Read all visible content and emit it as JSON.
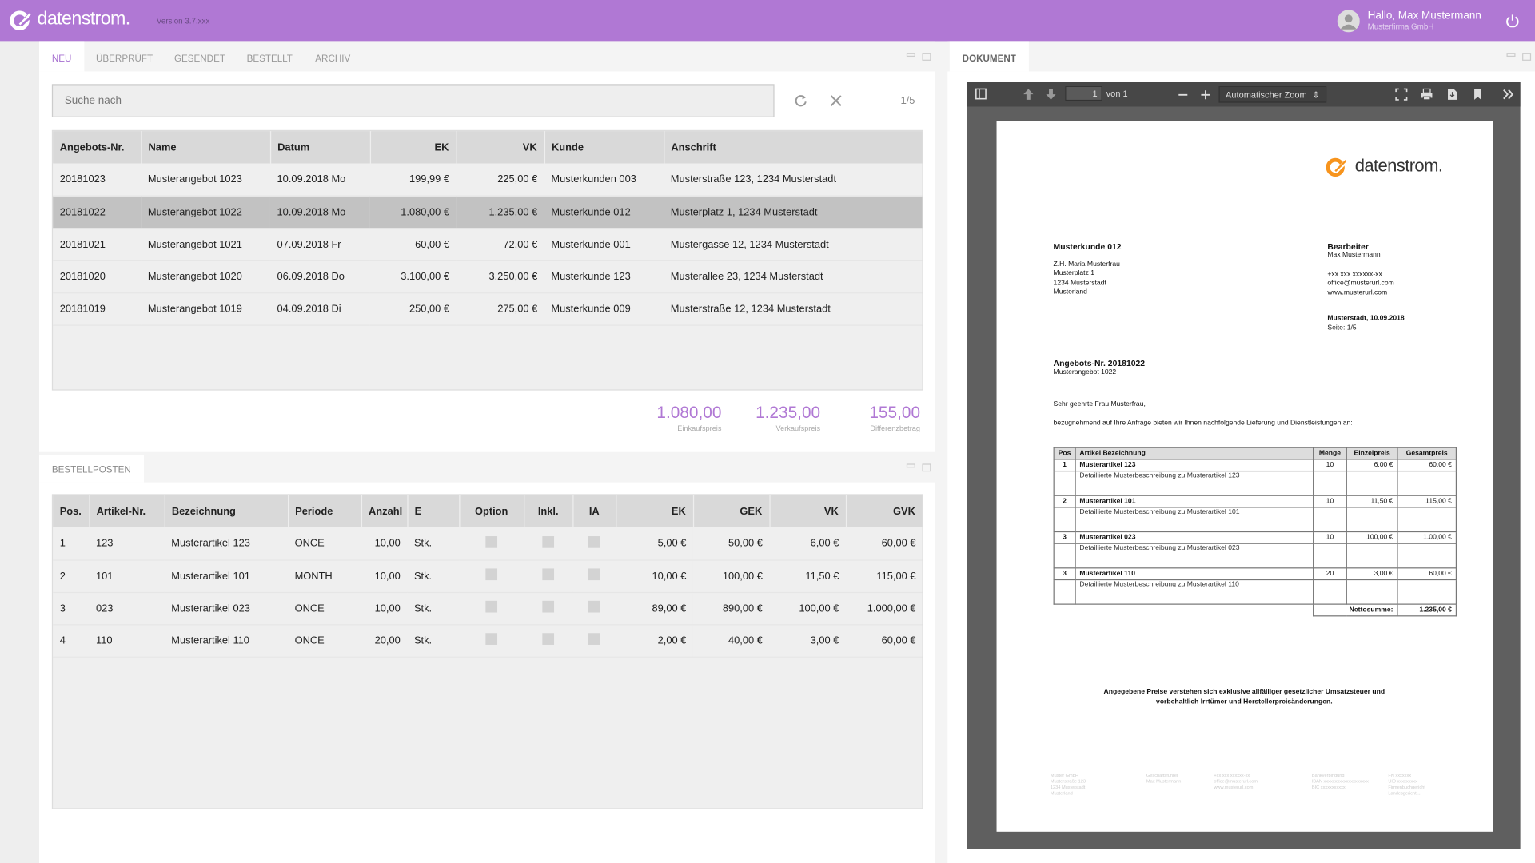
{
  "app": {
    "brand": "datenstrom.",
    "version": "Version 3.7.xxx",
    "accent": "#b078d4"
  },
  "user": {
    "greeting": "Hallo, Max Mustermann",
    "company": "Musterfirma GmbH"
  },
  "sidebar": {
    "items": [
      {
        "icon": "home-icon"
      },
      {
        "icon": "play-icon"
      },
      {
        "icon": "database-icon"
      },
      {
        "icon": "chart-ring-icon"
      },
      {
        "icon": "calculator-icon"
      },
      {
        "icon": "cube-icon"
      },
      {
        "icon": "calendar-icon"
      },
      {
        "icon": "document-icon"
      },
      {
        "icon": "ticket-icon"
      },
      {
        "icon": "shield-user-icon"
      }
    ],
    "settings_icon": "gear-icon"
  },
  "offers": {
    "tabs": [
      "NEU",
      "ÜBERPRÜFT",
      "GESENDET",
      "BESTELLT",
      "ARCHIV"
    ],
    "active_tab": "NEU",
    "search_placeholder": "Suche nach",
    "pager": "1/5",
    "columns": [
      "Angebots-Nr.",
      "Name",
      "Datum",
      "EK",
      "VK",
      "Kunde",
      "Anschrift"
    ],
    "rows": [
      [
        "20181023",
        "Musterangebot 1023",
        "10.09.2018 Mo",
        "199,99 €",
        "225,00 €",
        "Musterkunden 003",
        "Musterstraße 123, 1234 Musterstadt"
      ],
      [
        "20181022",
        "Musterangebot 1022",
        "10.09.2018 Mo",
        "1.080,00 €",
        "1.235,00 €",
        "Musterkunde 012",
        "Musterplatz 1, 1234 Musterstadt"
      ],
      [
        "20181021",
        "Musterangebot 1021",
        "07.09.2018 Fr",
        "60,00 €",
        "72,00 €",
        "Musterkunde 001",
        "Mustergasse 12, 1234 Musterstadt"
      ],
      [
        "20181020",
        "Musterangebot 1020",
        "06.09.2018 Do",
        "3.100,00 €",
        "3.250,00 €",
        "Musterkunde 123",
        "Musterallee 23, 1234 Musterstadt"
      ],
      [
        "20181019",
        "Musterangebot 1019",
        "04.09.2018 Di",
        "250,00 €",
        "275,00 €",
        "Musterkunde 009",
        "Musterstraße 12, 1234 Musterstadt"
      ]
    ],
    "selected_row": 1,
    "sums": [
      {
        "value": "1.080,00",
        "label": "Einkaufspreis"
      },
      {
        "value": "1.235,00",
        "label": "Verkaufspreis"
      },
      {
        "value": "155,00",
        "label": "Differenzbetrag"
      }
    ]
  },
  "positions": {
    "tab": "BESTELLPOSTEN",
    "columns": [
      "Pos.",
      "Artikel-Nr.",
      "Bezeichnung",
      "Periode",
      "Anzahl",
      "E",
      "Option",
      "Inkl.",
      "IA",
      "EK",
      "GEK",
      "VK",
      "GVK"
    ],
    "rows": [
      [
        "1",
        "123",
        "Musterartikel 123",
        "ONCE",
        "10,00",
        "Stk.",
        false,
        false,
        false,
        "5,00 €",
        "50,00 €",
        "6,00 €",
        "60,00 €"
      ],
      [
        "2",
        "101",
        "Musterartikel 101",
        "MONTH",
        "10,00",
        "Stk.",
        false,
        false,
        false,
        "10,00 €",
        "100,00 €",
        "11,50 €",
        "115,00 €"
      ],
      [
        "3",
        "023",
        "Musterartikel 023",
        "ONCE",
        "10,00",
        "Stk.",
        false,
        false,
        false,
        "89,00 €",
        "890,00 €",
        "100,00 €",
        "1.000,00 €"
      ],
      [
        "4",
        "110",
        "Musterartikel 110",
        "ONCE",
        "20,00",
        "Stk.",
        false,
        false,
        false,
        "2,00 €",
        "40,00 €",
        "3,00 €",
        "60,00 €"
      ]
    ]
  },
  "document": {
    "tab": "DOKUMENT",
    "viewer": {
      "page": "1",
      "of": "von 1",
      "zoom": "Automatischer Zoom"
    },
    "customer": {
      "name": "Musterkunde 012",
      "lines": [
        "Z.H. Maria Musterfrau",
        "Musterplatz 1",
        "1234 Musterstadt",
        "Musterland"
      ]
    },
    "clerk": {
      "title": "Bearbeiter",
      "name": "Max Mustermann",
      "lines": [
        "+xx xxx xxxxxx-xx",
        "office@musterurl.com",
        "www.musterurl.com"
      ]
    },
    "place_date": "Musterstadt, 10.09.2018",
    "page_info": "Seite: 1/5",
    "offer_no": "Angebots-Nr. 20181022",
    "offer_name": "Musterangebot 1022",
    "salutation": "Sehr geehrte Frau Musterfrau,",
    "intro": "bezugnehmend auf Ihre Anfrage bieten wir Ihnen nachfolgende Lieferung und Dienstleistungen an:",
    "table_columns": [
      "Pos",
      "Artikel Bezeichnung",
      "Menge",
      "Einzelpreis",
      "Gesamtpreis"
    ],
    "items": [
      {
        "pos": "1",
        "name": "Musterartikel 123",
        "desc": "Detaillierte Musterbeschreibung zu Musterartikel 123",
        "qty": "10",
        "unit": "6,00 €",
        "total": "60,00 €"
      },
      {
        "pos": "2",
        "name": "Musterartikel 101",
        "desc": "Detaillierte Musterbeschreibung zu Musterartikel 101",
        "qty": "10",
        "unit": "11,50 €",
        "total": "115,00 €"
      },
      {
        "pos": "3",
        "name": "Musterartikel 023",
        "desc": "Detaillierte Musterbeschreibung zu Musterartikel 023",
        "qty": "10",
        "unit": "100,00 €",
        "total": "1.00,00 €"
      },
      {
        "pos": "3",
        "name": "Musterartikel 110",
        "desc": "Detaillierte Musterbeschreibung zu Musterartikel 110",
        "qty": "20",
        "unit": "3,00 €",
        "total": "60,00 €"
      }
    ],
    "net_label": "Nettosumme:",
    "net_value": "1.235,00 €",
    "disclaimer": "Angegebene Preise verstehen sich exklusive allfälliger gesetzlicher Umsatzsteuer und vorbehaltlich Irrtümer und Herstellerpreisänderungen.",
    "footer": [
      [
        "Muster GmbH",
        "Musterstraße 123",
        "1234 Musterstadt",
        "Musterland"
      ],
      [
        "Geschäftsführer",
        "Max Mustermann"
      ],
      [
        "+xx xxx xxxxxx-xx",
        "office@musterurl.com",
        "www.musterurl.com"
      ],
      [
        "Bankverbindung",
        "IBAN  xxxxxxxxxxxxxxxxxxxx",
        "BIC   xxxxxxxxxxx"
      ],
      [
        "FN  xxxxxxx",
        "UID  xxxxxxxxx",
        "Firmenbuchgericht",
        "Landesgericht ..."
      ]
    ]
  }
}
